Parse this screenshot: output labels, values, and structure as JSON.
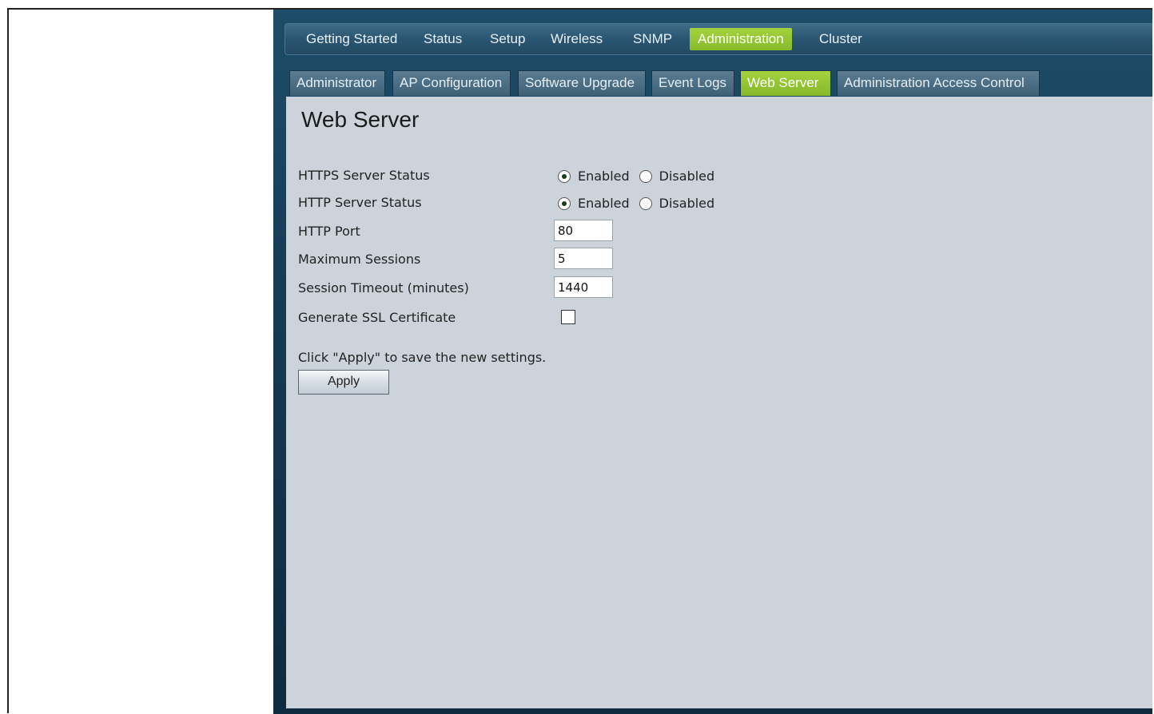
{
  "top_nav": {
    "items": [
      {
        "label": "Getting Started",
        "active": false
      },
      {
        "label": "Status",
        "active": false
      },
      {
        "label": "Setup",
        "active": false
      },
      {
        "label": "Wireless",
        "active": false
      },
      {
        "label": "SNMP",
        "active": false
      },
      {
        "label": "Administration",
        "active": true
      },
      {
        "label": "Cluster",
        "active": false
      }
    ]
  },
  "sub_tabs": {
    "items": [
      {
        "label": "Administrator",
        "active": false
      },
      {
        "label": "AP Configuration",
        "active": false
      },
      {
        "label": "Software Upgrade",
        "active": false
      },
      {
        "label": "Event Logs",
        "active": false
      },
      {
        "label": "Web Server",
        "active": true
      },
      {
        "label": "Administration Access Control",
        "active": false
      }
    ]
  },
  "page": {
    "title": "Web Server"
  },
  "form": {
    "https_status": {
      "label": "HTTPS Server Status",
      "enabled_label": "Enabled",
      "disabled_label": "Disabled",
      "value": "Enabled"
    },
    "http_status": {
      "label": "HTTP Server Status",
      "enabled_label": "Enabled",
      "disabled_label": "Disabled",
      "value": "Enabled"
    },
    "http_port": {
      "label": "HTTP Port",
      "value": "80"
    },
    "max_sessions": {
      "label": "Maximum Sessions",
      "value": "5"
    },
    "session_timeout": {
      "label": "Session Timeout (minutes)",
      "value": "1440"
    },
    "ssl_cert": {
      "label": "Generate SSL Certificate",
      "checked": false
    },
    "hint": "Click \"Apply\" to save the new settings.",
    "apply_label": "Apply"
  },
  "colors": {
    "active_tab": "#9acb35",
    "header_bg": "#1d4d69",
    "content_bg": "#cdd3db"
  }
}
